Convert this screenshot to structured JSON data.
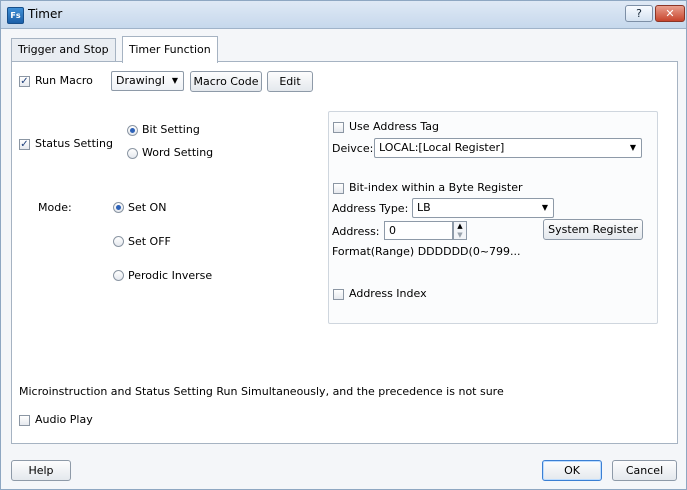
{
  "window": {
    "title": "Timer",
    "app_icon_text": "Fs",
    "help_btn": "?",
    "close_btn": "✕"
  },
  "tabs": [
    "Trigger and Stop",
    "Timer Function"
  ],
  "run_macro": {
    "label": "Run Macro",
    "checked": true,
    "combo_value": "DrawingI",
    "macro_code_btn": "Macro Code",
    "edit_btn": "Edit"
  },
  "status_setting": {
    "label": "Status Setting",
    "checked": true,
    "bit_setting": "Bit Setting",
    "word_setting": "Word Setting"
  },
  "mode": {
    "label": "Mode:",
    "set_on": "Set ON",
    "set_off": "Set OFF",
    "periodic_inverse": "Perodic Inverse"
  },
  "address": {
    "use_address_tag": "Use Address Tag",
    "device_label": "Deivce:",
    "device_value": "LOCAL:[Local Register]",
    "bit_index": "Bit-index within a Byte Register",
    "address_type_label": "Address Type:",
    "address_type_value": "LB",
    "address_label": "Address:",
    "address_value": "0",
    "system_register_btn": "System Register",
    "format_text": "Format(Range) DDDDDD(0~799...",
    "address_index": "Address Index"
  },
  "note": "Microinstruction and Status Setting Run Simultaneously, and the precedence is not sure",
  "audio_play": "Audio Play",
  "footer": {
    "help_btn": "Help",
    "ok_btn": "OK",
    "cancel_btn": "Cancel"
  }
}
